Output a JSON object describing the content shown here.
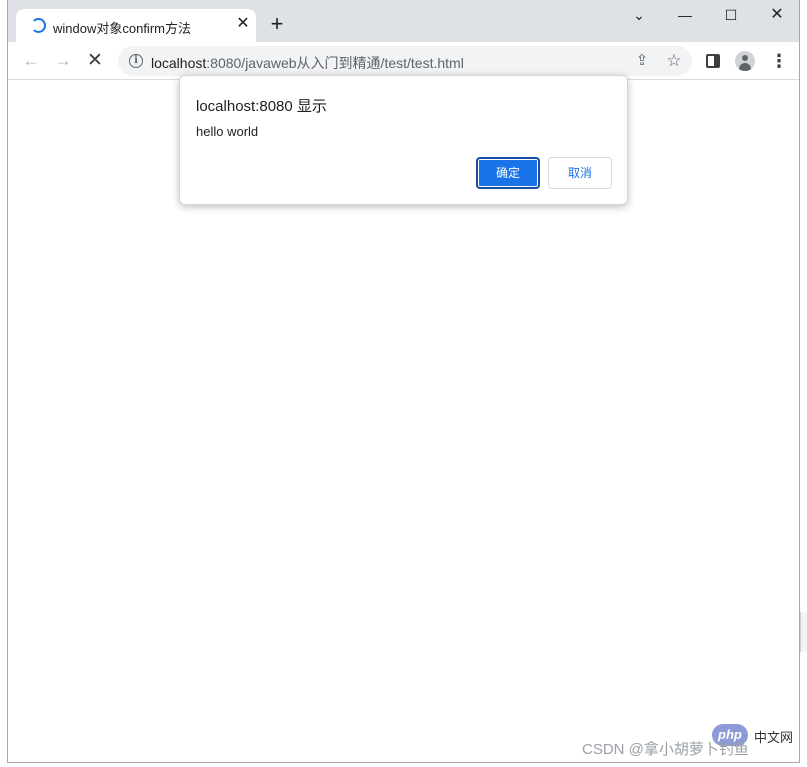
{
  "browser": {
    "tab": {
      "title": "window对象confirm方法",
      "close_label": "✕"
    },
    "new_tab_label": "+",
    "window_controls": {
      "menu": "⌄",
      "minimize": "—",
      "maximize": "☐",
      "close": "✕"
    },
    "toolbar": {
      "back_icon": "←",
      "forward_icon": "→",
      "stop_icon": "✕",
      "info_icon": "i",
      "share_icon": "⇪",
      "star_icon": "☆",
      "menu_icon": "⋮"
    },
    "address": {
      "host": "localhost",
      "rest": ":8080/javaweb从入门到精通/test/test.html"
    }
  },
  "dialog": {
    "title": "localhost:8080 显示",
    "message": "hello world",
    "ok_label": "确定",
    "cancel_label": "取消"
  },
  "watermark": {
    "badge": "php",
    "site": "中文网",
    "text": "CSDN @拿小胡萝卜钓鱼"
  },
  "colors": {
    "accent": "#1a73e8",
    "titlebar": "#dee1e6",
    "omnibox": "#f1f3f4"
  }
}
